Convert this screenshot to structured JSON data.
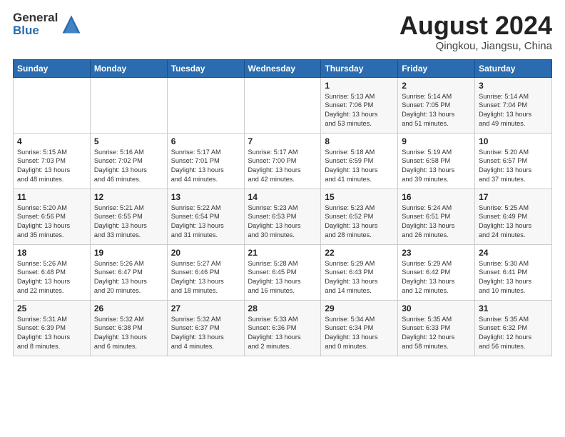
{
  "header": {
    "logo_line1": "General",
    "logo_line2": "Blue",
    "month": "August 2024",
    "location": "Qingkou, Jiangsu, China"
  },
  "weekdays": [
    "Sunday",
    "Monday",
    "Tuesday",
    "Wednesday",
    "Thursday",
    "Friday",
    "Saturday"
  ],
  "weeks": [
    [
      {
        "day": "",
        "info": ""
      },
      {
        "day": "",
        "info": ""
      },
      {
        "day": "",
        "info": ""
      },
      {
        "day": "",
        "info": ""
      },
      {
        "day": "1",
        "info": "Sunrise: 5:13 AM\nSunset: 7:06 PM\nDaylight: 13 hours\nand 53 minutes."
      },
      {
        "day": "2",
        "info": "Sunrise: 5:14 AM\nSunset: 7:05 PM\nDaylight: 13 hours\nand 51 minutes."
      },
      {
        "day": "3",
        "info": "Sunrise: 5:14 AM\nSunset: 7:04 PM\nDaylight: 13 hours\nand 49 minutes."
      }
    ],
    [
      {
        "day": "4",
        "info": "Sunrise: 5:15 AM\nSunset: 7:03 PM\nDaylight: 13 hours\nand 48 minutes."
      },
      {
        "day": "5",
        "info": "Sunrise: 5:16 AM\nSunset: 7:02 PM\nDaylight: 13 hours\nand 46 minutes."
      },
      {
        "day": "6",
        "info": "Sunrise: 5:17 AM\nSunset: 7:01 PM\nDaylight: 13 hours\nand 44 minutes."
      },
      {
        "day": "7",
        "info": "Sunrise: 5:17 AM\nSunset: 7:00 PM\nDaylight: 13 hours\nand 42 minutes."
      },
      {
        "day": "8",
        "info": "Sunrise: 5:18 AM\nSunset: 6:59 PM\nDaylight: 13 hours\nand 41 minutes."
      },
      {
        "day": "9",
        "info": "Sunrise: 5:19 AM\nSunset: 6:58 PM\nDaylight: 13 hours\nand 39 minutes."
      },
      {
        "day": "10",
        "info": "Sunrise: 5:20 AM\nSunset: 6:57 PM\nDaylight: 13 hours\nand 37 minutes."
      }
    ],
    [
      {
        "day": "11",
        "info": "Sunrise: 5:20 AM\nSunset: 6:56 PM\nDaylight: 13 hours\nand 35 minutes."
      },
      {
        "day": "12",
        "info": "Sunrise: 5:21 AM\nSunset: 6:55 PM\nDaylight: 13 hours\nand 33 minutes."
      },
      {
        "day": "13",
        "info": "Sunrise: 5:22 AM\nSunset: 6:54 PM\nDaylight: 13 hours\nand 31 minutes."
      },
      {
        "day": "14",
        "info": "Sunrise: 5:23 AM\nSunset: 6:53 PM\nDaylight: 13 hours\nand 30 minutes."
      },
      {
        "day": "15",
        "info": "Sunrise: 5:23 AM\nSunset: 6:52 PM\nDaylight: 13 hours\nand 28 minutes."
      },
      {
        "day": "16",
        "info": "Sunrise: 5:24 AM\nSunset: 6:51 PM\nDaylight: 13 hours\nand 26 minutes."
      },
      {
        "day": "17",
        "info": "Sunrise: 5:25 AM\nSunset: 6:49 PM\nDaylight: 13 hours\nand 24 minutes."
      }
    ],
    [
      {
        "day": "18",
        "info": "Sunrise: 5:26 AM\nSunset: 6:48 PM\nDaylight: 13 hours\nand 22 minutes."
      },
      {
        "day": "19",
        "info": "Sunrise: 5:26 AM\nSunset: 6:47 PM\nDaylight: 13 hours\nand 20 minutes."
      },
      {
        "day": "20",
        "info": "Sunrise: 5:27 AM\nSunset: 6:46 PM\nDaylight: 13 hours\nand 18 minutes."
      },
      {
        "day": "21",
        "info": "Sunrise: 5:28 AM\nSunset: 6:45 PM\nDaylight: 13 hours\nand 16 minutes."
      },
      {
        "day": "22",
        "info": "Sunrise: 5:29 AM\nSunset: 6:43 PM\nDaylight: 13 hours\nand 14 minutes."
      },
      {
        "day": "23",
        "info": "Sunrise: 5:29 AM\nSunset: 6:42 PM\nDaylight: 13 hours\nand 12 minutes."
      },
      {
        "day": "24",
        "info": "Sunrise: 5:30 AM\nSunset: 6:41 PM\nDaylight: 13 hours\nand 10 minutes."
      }
    ],
    [
      {
        "day": "25",
        "info": "Sunrise: 5:31 AM\nSunset: 6:39 PM\nDaylight: 13 hours\nand 8 minutes."
      },
      {
        "day": "26",
        "info": "Sunrise: 5:32 AM\nSunset: 6:38 PM\nDaylight: 13 hours\nand 6 minutes."
      },
      {
        "day": "27",
        "info": "Sunrise: 5:32 AM\nSunset: 6:37 PM\nDaylight: 13 hours\nand 4 minutes."
      },
      {
        "day": "28",
        "info": "Sunrise: 5:33 AM\nSunset: 6:36 PM\nDaylight: 13 hours\nand 2 minutes."
      },
      {
        "day": "29",
        "info": "Sunrise: 5:34 AM\nSunset: 6:34 PM\nDaylight: 13 hours\nand 0 minutes."
      },
      {
        "day": "30",
        "info": "Sunrise: 5:35 AM\nSunset: 6:33 PM\nDaylight: 12 hours\nand 58 minutes."
      },
      {
        "day": "31",
        "info": "Sunrise: 5:35 AM\nSunset: 6:32 PM\nDaylight: 12 hours\nand 56 minutes."
      }
    ]
  ]
}
